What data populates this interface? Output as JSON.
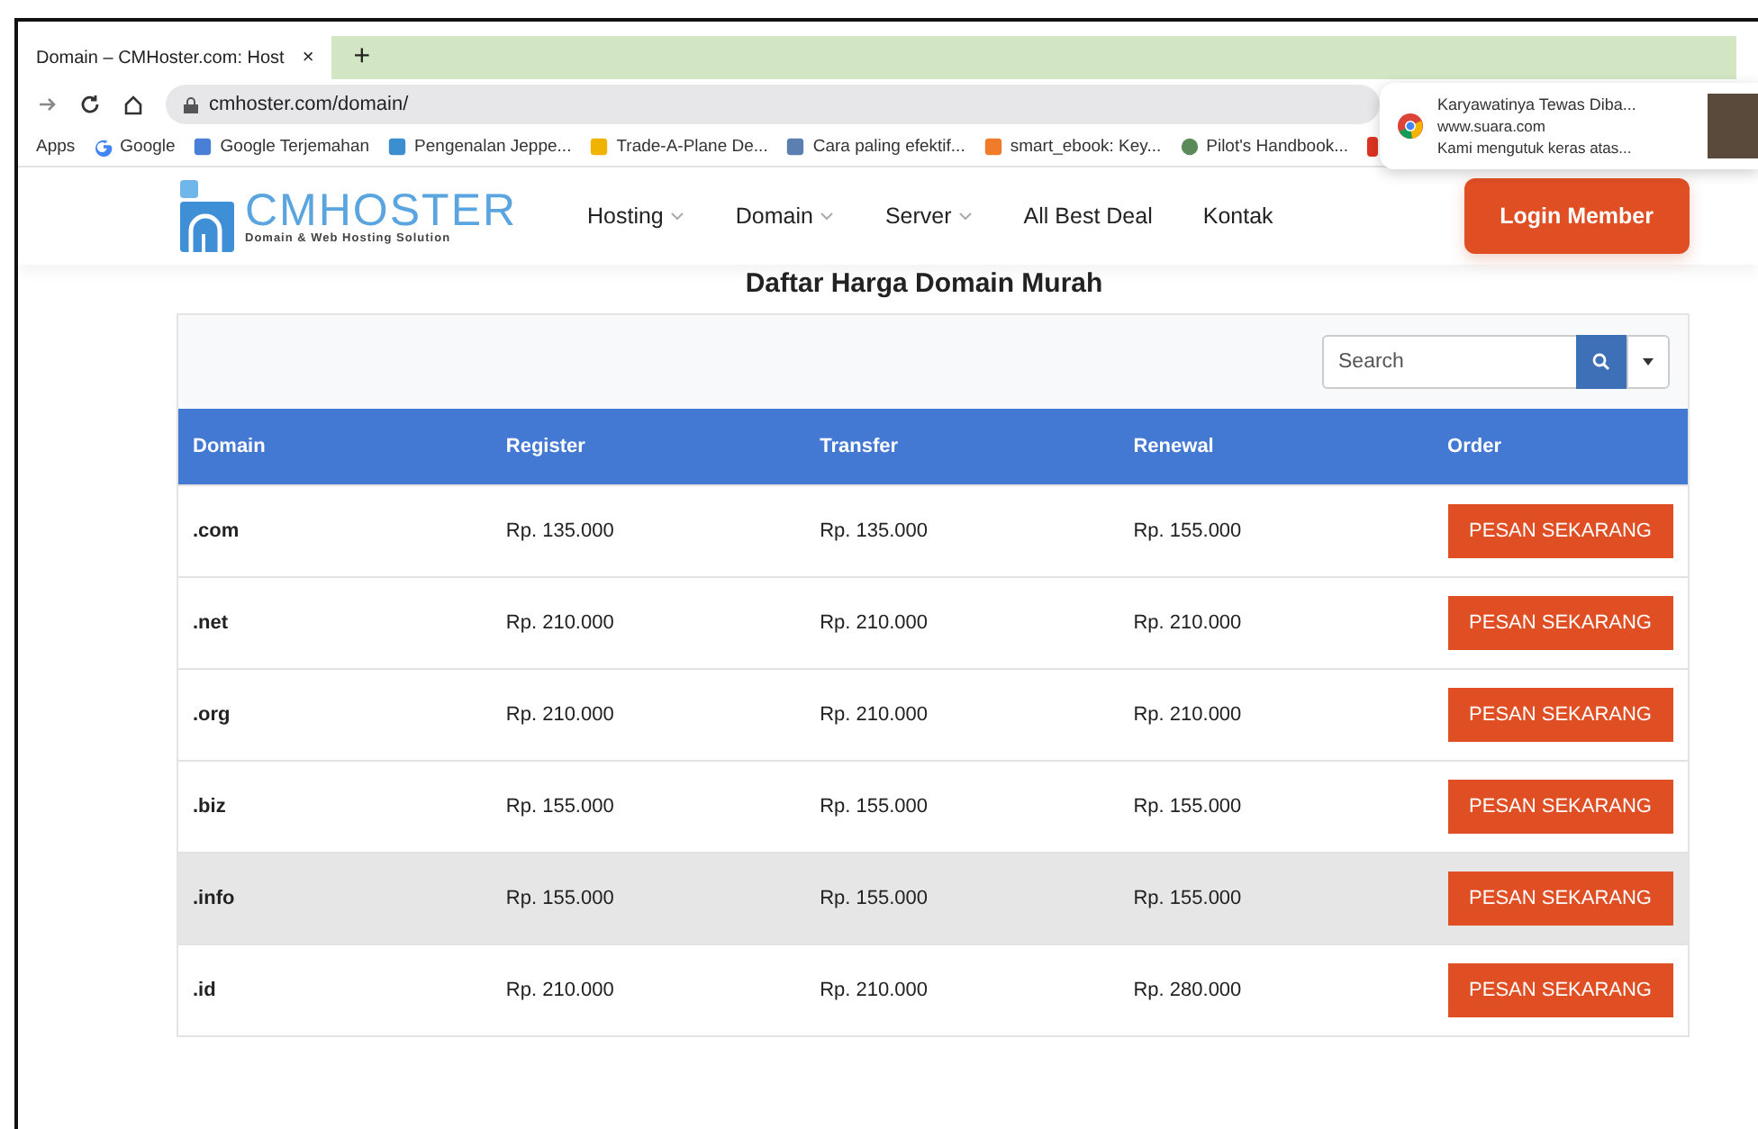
{
  "browser": {
    "tab": {
      "title": "Domain – CMHoster.com: Host",
      "close": "×"
    },
    "new_tab": "+",
    "url": "cmhoster.com/domain/",
    "bookmarks": [
      "Apps",
      "Google",
      "Google Terjemahan",
      "Pengenalan Jeppe...",
      "Trade-A-Plane De...",
      "Cara paling efektif...",
      "smart_ebook: Key...",
      "Pilot's Handbook..."
    ]
  },
  "notification": {
    "title": "Karyawatinya Tewas Diba...",
    "site": "www.suara.com",
    "message": "Kami mengutuk keras atas..."
  },
  "site": {
    "logo": {
      "name": "CMHOSTER",
      "tagline": "Domain & Web Hosting Solution"
    },
    "nav": [
      {
        "label": "Hosting",
        "dropdown": true
      },
      {
        "label": "Domain",
        "dropdown": true
      },
      {
        "label": "Server",
        "dropdown": true
      },
      {
        "label": "All Best Deal",
        "dropdown": false
      },
      {
        "label": "Kontak",
        "dropdown": false
      }
    ],
    "login": "Login Member"
  },
  "heading": "Daftar Harga Domain Murah",
  "table": {
    "search": {
      "placeholder": "Search"
    },
    "columns": [
      "Domain",
      "Register",
      "Transfer",
      "Renewal",
      "Order"
    ],
    "rows": [
      {
        "domain": ".com",
        "register": "Rp. 135.000",
        "transfer": "Rp. 135.000",
        "renewal": "Rp. 155.000",
        "order": "PESAN SEKARANG",
        "hovered": false
      },
      {
        "domain": ".net",
        "register": "Rp. 210.000",
        "transfer": "Rp. 210.000",
        "renewal": "Rp. 210.000",
        "order": "PESAN SEKARANG",
        "hovered": false
      },
      {
        "domain": ".org",
        "register": "Rp. 210.000",
        "transfer": "Rp. 210.000",
        "renewal": "Rp. 210.000",
        "order": "PESAN SEKARANG",
        "hovered": false
      },
      {
        "domain": ".biz",
        "register": "Rp. 155.000",
        "transfer": "Rp. 155.000",
        "renewal": "Rp. 155.000",
        "order": "PESAN SEKARANG",
        "hovered": false
      },
      {
        "domain": ".info",
        "register": "Rp. 155.000",
        "transfer": "Rp. 155.000",
        "renewal": "Rp. 155.000",
        "order": "PESAN SEKARANG",
        "hovered": true
      },
      {
        "domain": ".id",
        "register": "Rp. 210.000",
        "transfer": "Rp. 210.000",
        "renewal": "Rp. 280.000",
        "order": "PESAN SEKARANG",
        "hovered": false
      }
    ]
  }
}
